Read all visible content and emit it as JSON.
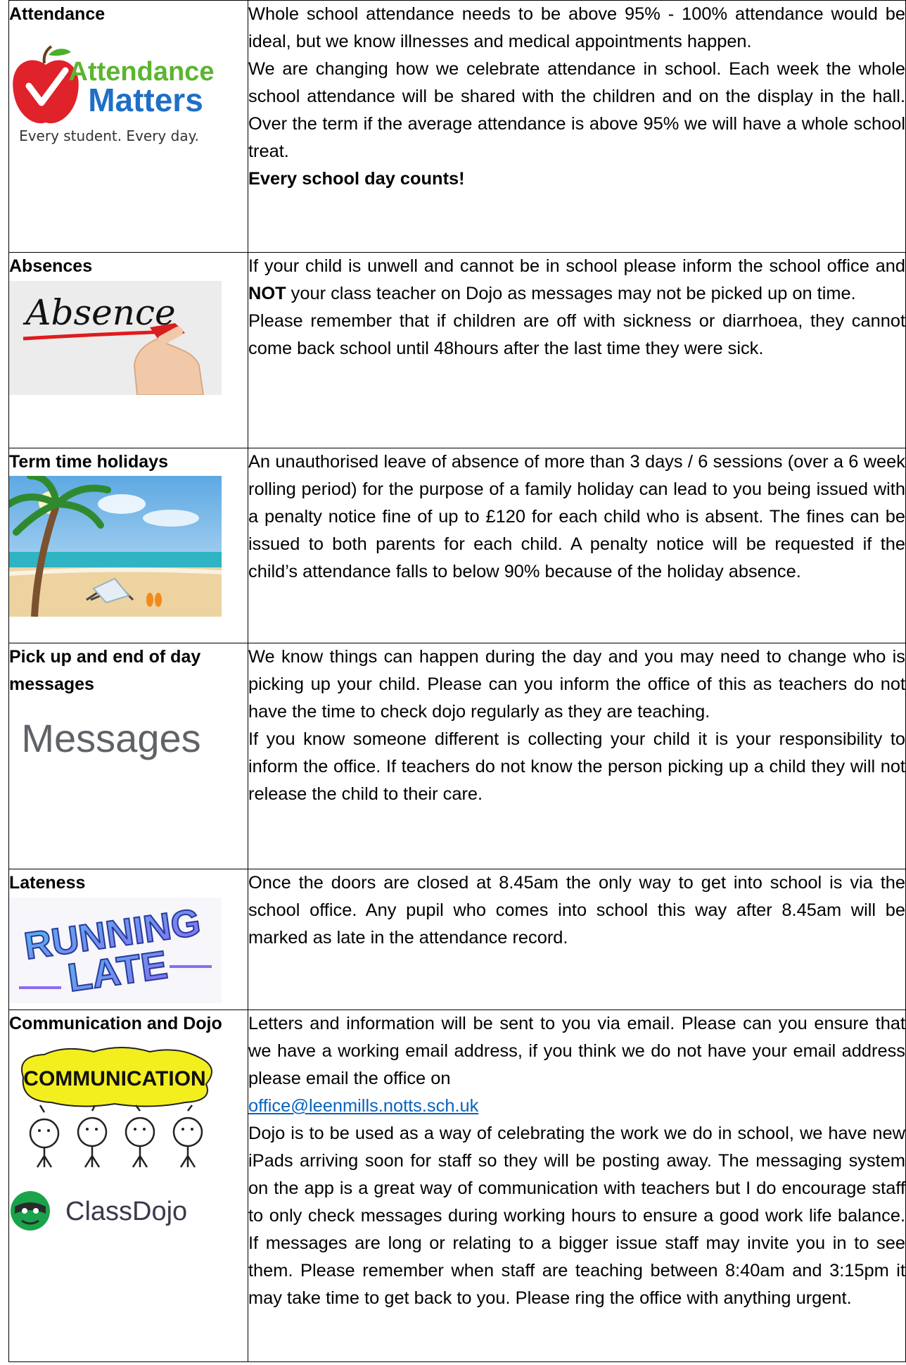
{
  "rows": [
    {
      "heading": "Attendance",
      "logo": {
        "line1": "Attendance",
        "line2": "Matters",
        "tagline": "Every student. Every day.",
        "apple_color": "#e0222a",
        "text_green": "#5bb530",
        "text_blue": "#1f6fc5"
      },
      "paragraphs": [
        "Whole school attendance needs to be above 95% - 100% attendance would be ideal, but we know illnesses and medical appointments happen.",
        "We are changing how we celebrate attendance in school. Each week the whole school attendance will be shared with the children and on the display in the hall. Over the term if the average attendance is above 95% we will have a whole school treat."
      ],
      "bold_line": "Every school day counts!"
    },
    {
      "heading": "Absences",
      "image_text": "Absence",
      "p1_a": "If your child is unwell and cannot be in school please inform the school office and ",
      "p1_bold": "NOT",
      "p1_b": " your class teacher on Dojo as messages may not be picked up on time.",
      "p2": "Please remember that if children are off with sickness or diarrhoea, they cannot come back school until 48hours after the last time they were sick."
    },
    {
      "heading": "Term time holidays",
      "paragraph": "An unauthorised leave of absence of more than 3 days / 6 sessions (over a 6 week rolling period) for the purpose of a family holiday can lead to you being issued with a penalty notice fine of up to £120 for each child who is absent. The fines can be issued to both parents for each child. A penalty notice will be requested if the child’s attendance falls to below 90% because of the holiday absence."
    },
    {
      "heading": "Pick up and end of day messages",
      "image_text": "Messages",
      "paragraphs": [
        "We know things can happen during the day and you may need to change who is picking up your child. Please can you inform the office of this as teachers do not have the time to check dojo regularly as they are teaching.",
        "If you know someone different is collecting your child it is your responsibility to inform the office. If teachers do not know the person picking up a child they will not release the child to their care."
      ]
    },
    {
      "heading": "Lateness",
      "image_line1": "RUNNING",
      "image_line2": "LATE",
      "paragraph": "Once the doors are closed at 8.45am the only way to get into school is via the school office. Any pupil who comes into school this way after 8.45am will be marked as late in the attendance record."
    },
    {
      "heading": "Communication and Dojo",
      "image_text": "COMMUNICATION",
      "dojo_text": "ClassDojo",
      "p1": "Letters and information will be sent to you via email. Please can you ensure that we have a working email address, if you think we do not have your email address please email the office on",
      "email": "office@leenmills.notts.sch.uk",
      "p2": "Dojo is to be used as a way of celebrating the work we do in school, we have new iPads arriving soon for staff so they will be posting away. The messaging system on the app is a great way of communication with teachers but I do encourage staff to only check messages during working hours to ensure a good work life balance. If messages are long or relating to a bigger issue staff may invite you in to see them. Please remember when staff are teaching between 8:40am and 3:15pm it may take time to get back to you. Please ring the office with anything urgent."
    }
  ]
}
